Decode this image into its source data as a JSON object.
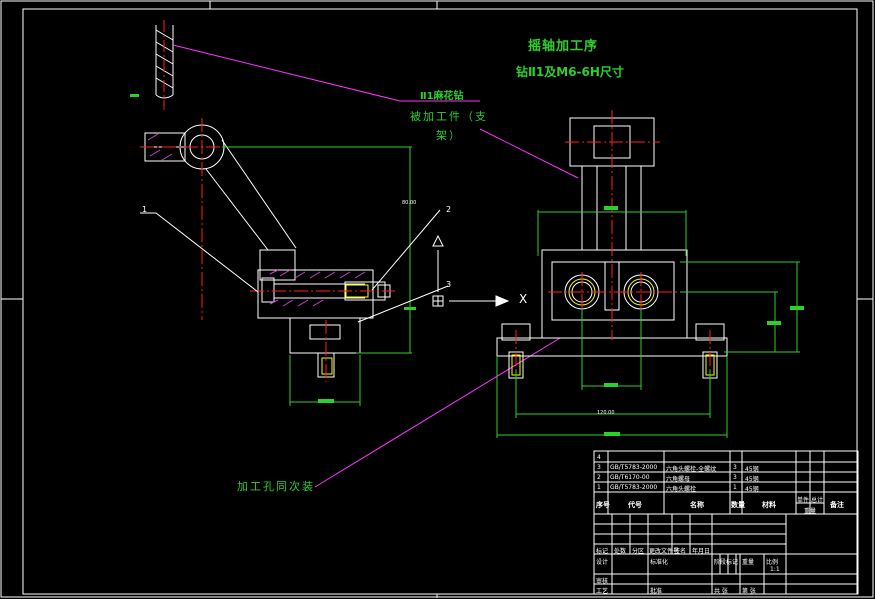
{
  "titles": {
    "line1": "摇轴加工序",
    "line2": "钻Ⅱ1及M6-6H尺寸"
  },
  "annotations": {
    "drill_tag": "Ⅱ1麻花钻",
    "workpiece_line1": "被加工件（支",
    "workpiece_line2": "架）",
    "hole_requirement": "加工孔同次装"
  },
  "callouts": {
    "c1": "1",
    "c2": "2",
    "c3": "3"
  },
  "dimensions": {
    "left_height": "80.00",
    "front_width": "120.00",
    "direction_x": "X"
  },
  "parts_list": {
    "rows": [
      {
        "no": "4",
        "code": "",
        "name": "",
        "qty": "",
        "material": ""
      },
      {
        "no": "3",
        "code": "GB/T5783-2000",
        "name": "六角头螺栓-全螺纹",
        "qty": "3",
        "material": "45钢"
      },
      {
        "no": "2",
        "code": "GB/T6170-00",
        "name": "六角螺母",
        "qty": "3",
        "material": "45钢"
      },
      {
        "no": "1",
        "code": "GB/T5783-2000",
        "name": "六角头螺栓",
        "qty": "1",
        "material": "45钢"
      }
    ],
    "header": {
      "no": "序号",
      "code": "代号",
      "name": "名称",
      "qty": "数量",
      "material": "材料",
      "unit_weight": "单件",
      "total_weight": "总计",
      "weight": "重量",
      "remark": "备注"
    }
  },
  "title_block": {
    "labels": {
      "mark": "标记",
      "count": "处数",
      "zone": "分区",
      "change_doc": "更改文件号",
      "sign": "签名",
      "date": "年月日",
      "design": "设计",
      "standard": "标准化",
      "review": "审核",
      "process": "工艺",
      "approve": "批准",
      "stage_mark": "阶段标记",
      "weight": "重量",
      "scale": "比例",
      "scale_value": "1:1",
      "sheets": "共 张",
      "sheet": "第 张"
    }
  },
  "colors": {
    "background": "#000000",
    "outline": "#ffffff",
    "center_line": "#ff2020",
    "dimension": "#2bd12b",
    "hatch": "#d040d0",
    "leader": "#ff33ff",
    "bolt": "#ffff00"
  }
}
